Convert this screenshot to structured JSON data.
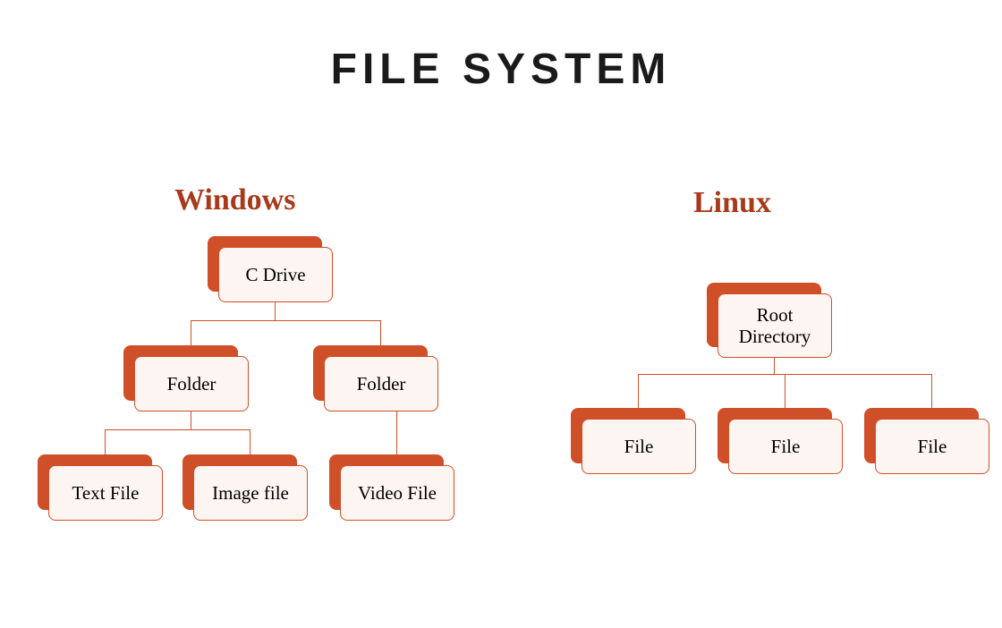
{
  "title": "FILE SYSTEM",
  "windows": {
    "heading": "Windows",
    "root": "C Drive",
    "folder1": "Folder",
    "folder2": "Folder",
    "textfile": "Text File",
    "imagefile": "Image file",
    "videofile": "Video File"
  },
  "linux": {
    "heading": "Linux",
    "root": "Root Directory",
    "file1": "File",
    "file2": "File",
    "file3": "File"
  }
}
